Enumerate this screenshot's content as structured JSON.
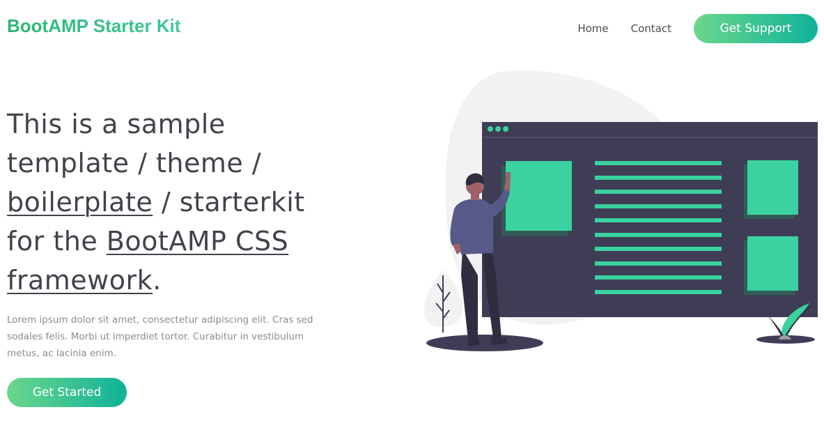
{
  "header": {
    "brand": "BootAMP Starter Kit",
    "nav": {
      "home": "Home",
      "contact": "Contact",
      "support_button": "Get Support"
    }
  },
  "hero": {
    "title_part1": "This is a sample template / theme / ",
    "title_link1": "boilerplate",
    "title_part2": " / starterkit for the ",
    "title_link2": "BootAMP CSS framework",
    "title_end": ".",
    "description": "Lorem ipsum dolor sit amet, consectetur adipiscing elit. Cras sed sodales felis. Morbi ut imperdiet tortor. Curabitur in vestibulum metus, ac lacinia enim.",
    "cta_button": "Get Started"
  },
  "colors": {
    "accent_green": "#3ad29f",
    "gradient_start": "#6bd68b",
    "gradient_end": "#0fb29a",
    "browser_dark": "#3f3d56",
    "blob_gray": "#f2f2f2"
  },
  "illustration": {
    "icon": "person-at-browser-window-illustration"
  }
}
